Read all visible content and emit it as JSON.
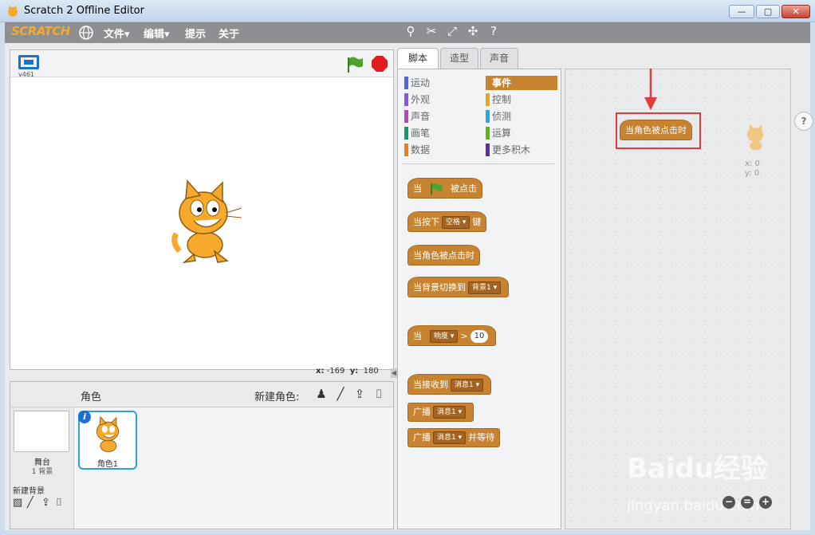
{
  "window": {
    "title": "Scratch 2 Offline Editor",
    "min": "—",
    "max": "▢",
    "close": "✕"
  },
  "menubar": {
    "logo": "SCRATCH",
    "items": [
      "文件▾",
      "编辑▾",
      "提示",
      "关于"
    ]
  },
  "stage": {
    "version": "v461",
    "x_label": "x:",
    "x_value": "-169",
    "y_label": "y:",
    "y_value": "180"
  },
  "sprites": {
    "title": "角色",
    "new_sprite_label": "新建角色:",
    "stage_name": "舞台",
    "stage_bg_count": "1 背景",
    "new_backdrop_label": "新建背景",
    "sprite_name": "角色1",
    "info_badge": "i"
  },
  "tabs": [
    "脚本",
    "造型",
    "声音"
  ],
  "categories": [
    {
      "label": "运动",
      "color": "#4a6cd4"
    },
    {
      "label": "事件",
      "color": "#c88330",
      "selected": true
    },
    {
      "label": "外观",
      "color": "#8a55d7"
    },
    {
      "label": "控制",
      "color": "#e1a91a"
    },
    {
      "label": "声音",
      "color": "#bb42c3"
    },
    {
      "label": "侦测",
      "color": "#2ca5e2"
    },
    {
      "label": "画笔",
      "color": "#0e9a6c"
    },
    {
      "label": "运算",
      "color": "#5cb712"
    },
    {
      "label": "数据",
      "color": "#ee7d16"
    },
    {
      "label": "更多积木",
      "color": "#632d99"
    }
  ],
  "blocks": {
    "flag_when": "当",
    "flag_clicked": "被点击",
    "key_pressed": "当按下",
    "key_value": "空格",
    "key_suffix": "键",
    "sprite_clicked": "当角色被点击时",
    "backdrop_switch": "当背景切换到",
    "backdrop_value": "背景1",
    "when": "当",
    "loudness": "响度",
    "gt": ">",
    "threshold": "10",
    "receive": "当接收到",
    "message": "消息1",
    "broadcast": "广播",
    "broadcast_wait": "广播",
    "and_wait": "并等待"
  },
  "script_area": {
    "canvas_block": "当角色被点击时",
    "sprite_x": "x: 0",
    "sprite_y": "y: 0"
  },
  "help": "?",
  "watermark": {
    "logo": "Baidu经验",
    "url": "jingyan.baidu.com"
  }
}
